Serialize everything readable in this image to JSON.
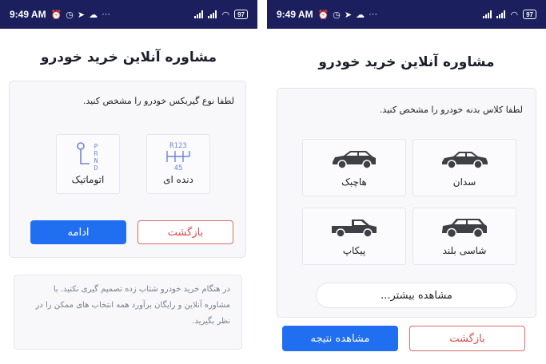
{
  "status_bar": {
    "time": "9:49 AM",
    "icons": [
      "alarm-icon",
      "clock-icon",
      "telegram-icon",
      "cloud-icon",
      "more-icon"
    ],
    "overflow": "···",
    "battery": "97"
  },
  "left_screen": {
    "title": "مشاوره آنلاین خرید خودرو",
    "prompt": "لطفا نوع گیربکس خودرو را مشخص کنید.",
    "options": [
      {
        "label": "دنده ای",
        "icon": "manual-gear-icon",
        "icon_text_top": "R123",
        "icon_text_bottom": "45"
      },
      {
        "label": "اتوماتیک",
        "icon": "automatic-gear-icon",
        "icon_text": "PRND"
      }
    ],
    "back_label": "بازگشت",
    "continue_label": "ادامه",
    "note": "در هنگام خرید خودرو شتاب زده تصمیم گیری نکنید. با مشاوره آنلاین و رایگان برآورد همه انتخاب های ممکن را در نظر بگیرید."
  },
  "right_screen": {
    "title": "مشاوره آنلاین خرید خودرو",
    "prompt": "لطفا کلاس بدنه خودرو را مشخص کنید.",
    "options": [
      {
        "label": "سدان",
        "icon": "sedan-car-icon"
      },
      {
        "label": "هاچبک",
        "icon": "hatchback-car-icon"
      },
      {
        "label": "شاسی بلند",
        "icon": "suv-car-icon"
      },
      {
        "label": "پیکاپ",
        "icon": "pickup-truck-icon"
      }
    ],
    "more_label": "مشاهده بیشتر...",
    "back_label": "بازگشت",
    "result_label": "مشاهده نتیجه"
  },
  "colors": {
    "status_bar": "#1b1f5e",
    "primary": "#1f6ff0",
    "danger": "#d94a4a",
    "icon_blue": "#6b86d6"
  }
}
